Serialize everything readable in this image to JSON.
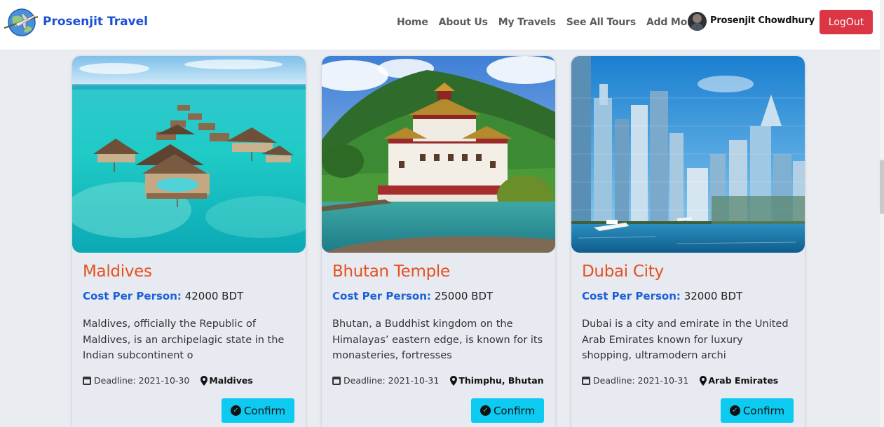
{
  "brand": {
    "name": "Prosenjit Travel",
    "logo_icon": "airplane-globe-icon"
  },
  "nav": {
    "links": [
      "Home",
      "About Us",
      "My Travels",
      "See All Tours",
      "Add More"
    ],
    "user_name": "Prosenjit Chowdhury",
    "logout_label": "LogOut"
  },
  "colors": {
    "brand": "#1d4fd6",
    "title": "#e3511f",
    "cost_label": "#1c5fd6",
    "logout": "#dc3545",
    "confirm": "#0dcaf0",
    "page_bg": "#e9ecf1"
  },
  "cost_prefix": "Cost Per Person:",
  "deadline_prefix": "Deadline:",
  "confirm_label": "Confirm",
  "tours": [
    {
      "title": "Maldives",
      "cost": "42000 BDT",
      "description": "Maldives, officially the Republic of Maldives, is an archipelagic state in the Indian subcontinent o",
      "deadline": "2021-10-30",
      "location": "Maldives",
      "image": "maldives-water-villas"
    },
    {
      "title": "Bhutan Temple",
      "cost": "25000 BDT",
      "description": "Bhutan, a Buddhist kingdom on the Himalayas’ eastern edge, is known for its monasteries, fortresses",
      "deadline": "2021-10-31",
      "location": "Thimphu, Bhutan",
      "image": "bhutan-dzong-river"
    },
    {
      "title": "Dubai City",
      "cost": "32000 BDT",
      "description": "Dubai is a city and emirate in the United Arab Emirates known for luxury shopping, ultramodern archi",
      "deadline": "2021-10-31",
      "location": "Arab Emirates",
      "image": "dubai-marina-skyline"
    }
  ]
}
